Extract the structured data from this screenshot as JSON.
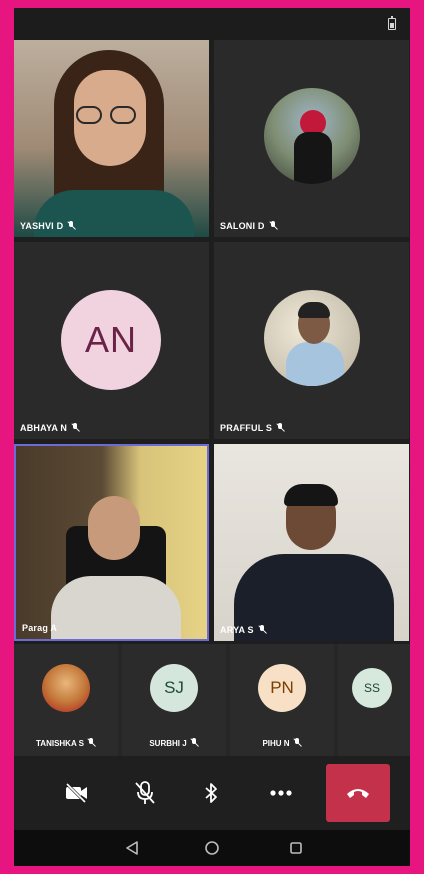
{
  "status_bar": {
    "battery_icon": "battery-icon"
  },
  "participants": [
    {
      "name": "YASHVI D",
      "muted": true,
      "video": true
    },
    {
      "name": "SALONI D",
      "muted": true,
      "avatar": "photo"
    },
    {
      "name": "ABHAYA N",
      "muted": true,
      "initials": "AN"
    },
    {
      "name": "PRAFFUL S",
      "muted": true,
      "avatar": "photo"
    },
    {
      "name": "Parag A",
      "muted": false,
      "video": true,
      "active_speaker": true
    },
    {
      "name": "ARYA S",
      "muted": true,
      "video": true
    }
  ],
  "strip": [
    {
      "name": "TANISHKA S",
      "muted": true,
      "avatar": "photo"
    },
    {
      "name": "SURBHI J",
      "muted": true,
      "initials": "SJ"
    },
    {
      "name": "PIHU N",
      "muted": true,
      "initials": "PN"
    },
    {
      "name": "",
      "initials": "SS"
    }
  ],
  "controls": {
    "camera": "camera-off-icon",
    "mic": "mic-off-icon",
    "audio": "bluetooth-icon",
    "more": "more-icon",
    "end_call": "hang-up-icon"
  },
  "navigation": [
    "back-icon",
    "home-icon",
    "recents-icon"
  ],
  "colors": {
    "frame": "#e6157f",
    "background": "#1e1e1e",
    "tile": "#2a2a2a",
    "active_speaker_border": "#6f6bd6",
    "end_call": "#c4314b"
  }
}
